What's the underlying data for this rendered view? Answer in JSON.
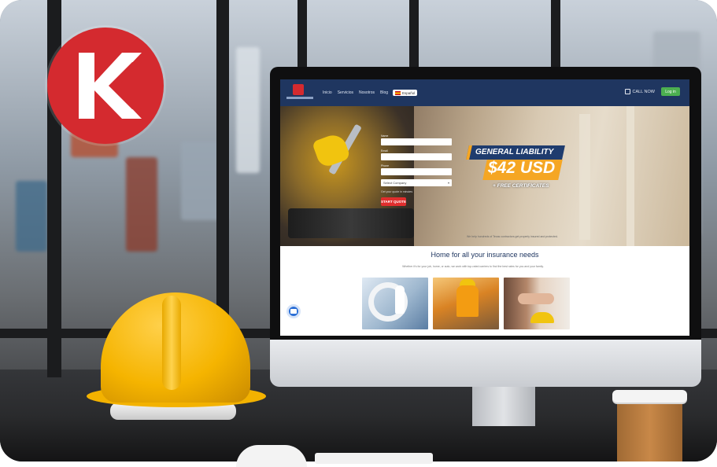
{
  "logo": {
    "alt": "K logo",
    "color": "#d42a2f"
  },
  "site": {
    "nav": {
      "links": [
        "Inicio",
        "Servicios",
        "Nosotros",
        "Blog",
        "Español"
      ],
      "language": "Español",
      "call_now": "CALL NOW",
      "login": "Log in"
    },
    "quote_form": {
      "field_labels": [
        "Name",
        "Email",
        "Phone"
      ],
      "select_value": "Select Company",
      "note": "Get your quote in minutes",
      "submit": "START QUOTE"
    },
    "promo": {
      "ribbon": "GENERAL LIABILITY",
      "price": "$42 USD",
      "extra": "+ FREE CERTIFICATES"
    },
    "hero_subtext": "We help hundreds of Texas contractors get properly insured and protected.",
    "section_title": "Home for all your insurance needs",
    "section_blurb": "Whether it's for your job, home, or auto, we work with top-rated carriers to find the best rates for you and your family.",
    "cards": [
      {
        "name": "health"
      },
      {
        "name": "construction"
      },
      {
        "name": "business"
      }
    ]
  },
  "colors": {
    "brand_red": "#d42a2f",
    "navy": "#1f3660",
    "promo_orange": "#f5a623",
    "login_green": "#4caf50"
  }
}
